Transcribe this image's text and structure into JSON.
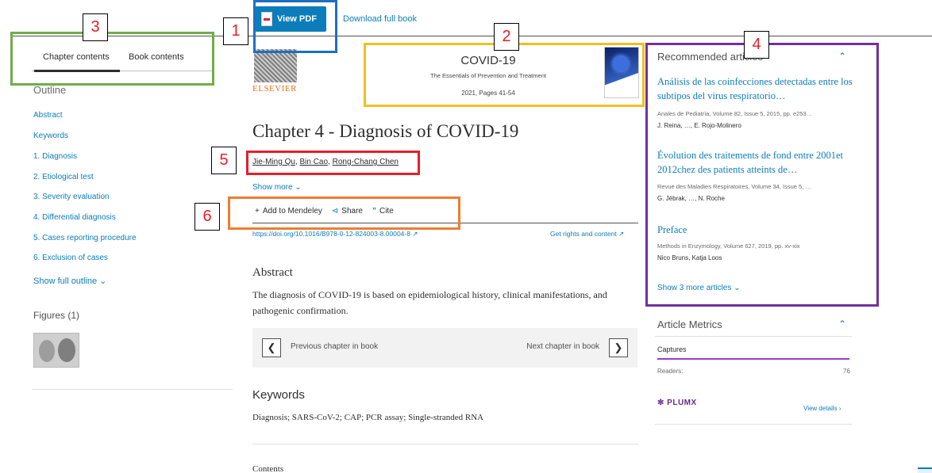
{
  "toolbar": {
    "view_pdf_label": "View PDF",
    "download_label": "Download full book"
  },
  "tabs": [
    {
      "label": "Chapter contents",
      "active": true
    },
    {
      "label": "Book contents",
      "active": false
    }
  ],
  "outline": {
    "title": "Outline",
    "items": [
      "Abstract",
      "Keywords",
      "1. Diagnosis",
      "2. Etiological test",
      "3. Severity evaluation",
      "4. Differential diagnosis",
      "5. Cases reporting procedure",
      "6. Exclusion of cases"
    ],
    "show_full_label": "Show full outline",
    "figures_title": "Figures (1)"
  },
  "book": {
    "publisher": "ELSEVIER",
    "title": "COVID-19",
    "subtitle": "The Essentials of Prevention and Treatment",
    "pages": "2021, Pages 41-54"
  },
  "chapter": {
    "title": "Chapter 4 - Diagnosis of COVID-19",
    "authors": [
      "Jie-Ming Qu",
      "Bin Cao",
      "Rong-Chang Chen"
    ],
    "show_more_label": "Show more",
    "actions": {
      "mendeley": "Add to Mendeley",
      "share": "Share",
      "cite": "Cite"
    },
    "doi": "https://doi.org/10.1016/B978-0-12-824003-8.00004-8",
    "rights": "Get rights and content"
  },
  "abstract": {
    "title": "Abstract",
    "body": "The diagnosis of COVID-19 is based on epidemiological history, clinical manifestations, and pathogenic confirmation."
  },
  "chapter_nav": {
    "prev_label": "Previous chapter in book",
    "next_label": "Next chapter in book"
  },
  "keywords": {
    "title": "Keywords",
    "body": "Diagnosis; SARS-CoV-2; CAP; PCR assay; Single-stranded RNA"
  },
  "contents_title": "Contents",
  "recommended": {
    "title": "Recommended articles",
    "items": [
      {
        "title": "Análisis de las coinfecciones detectadas entre los subtipos del virus respiratorio…",
        "source": "Anales de Pediatría, Volume 82, Issue 5, 2015, pp. e253…",
        "authors": "J. Reina, …, E. Rojo-Molinero"
      },
      {
        "title": "Évolution des traitements de fond entre 2001et 2012chez des patients atteints de…",
        "source": "Revue des Maladies Respiratoires, Volume 34, Issue 5, …",
        "authors": "G. Jébrak, …, N. Roche"
      },
      {
        "title": "Preface",
        "source": "Methods in Enzymology, Volume 627, 2019, pp. xv-xix",
        "authors": "Nico Bruns, Katja Loos"
      }
    ],
    "show_more_label": "Show 3 more articles"
  },
  "metrics": {
    "title": "Article Metrics",
    "captures_label": "Captures",
    "readers_label": "Readers:",
    "readers_count": "76",
    "plumx_label": "PLUMX",
    "view_details_label": "View details"
  },
  "annotations": {
    "labels": [
      "1",
      "2",
      "3",
      "4",
      "5",
      "6"
    ],
    "colors": {
      "1": "#1f6fbf",
      "2": "#f0c020",
      "3": "#70ad47",
      "4": "#7030a0",
      "5": "#e4202a",
      "6": "#ed7d31"
    }
  },
  "colors": {
    "link": "#0c7dbb",
    "accent_purple": "#9b3bc9",
    "publisher_orange": "#e9711c"
  }
}
